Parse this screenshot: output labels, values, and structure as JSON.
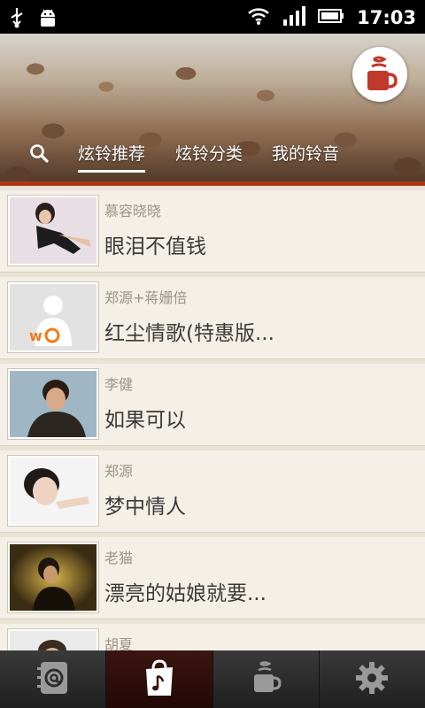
{
  "status_bar": {
    "time": "17:03",
    "left_icons": [
      "usb-icon",
      "android-debug-icon"
    ],
    "right_icons": [
      "wifi-icon",
      "signal-icon",
      "battery-icon"
    ]
  },
  "header": {
    "logo_icon": "coffee-cup-icon",
    "search_icon": "search-icon",
    "tabs": [
      {
        "label": "炫铃推荐",
        "active": true
      },
      {
        "label": "炫铃分类",
        "active": false
      },
      {
        "label": "我的铃音",
        "active": false
      }
    ],
    "accent_color": "#b03418"
  },
  "songs": [
    {
      "artist": "慕容晓晓",
      "title": "眼泪不值钱"
    },
    {
      "artist": "郑源+蒋姗倍",
      "title": "红尘情歌(特惠版..."
    },
    {
      "artist": "李健",
      "title": "如果可以"
    },
    {
      "artist": "郑源",
      "title": "梦中情人"
    },
    {
      "artist": "老猫",
      "title": "漂亮的姑娘就要..."
    },
    {
      "artist": "胡夏",
      "title": ""
    }
  ],
  "bottom_nav": [
    {
      "icon": "contacts-at-icon",
      "active": false
    },
    {
      "icon": "music-bag-icon",
      "active": true
    },
    {
      "icon": "coffee-cup-icon",
      "active": false
    },
    {
      "icon": "gear-icon",
      "active": false
    }
  ]
}
